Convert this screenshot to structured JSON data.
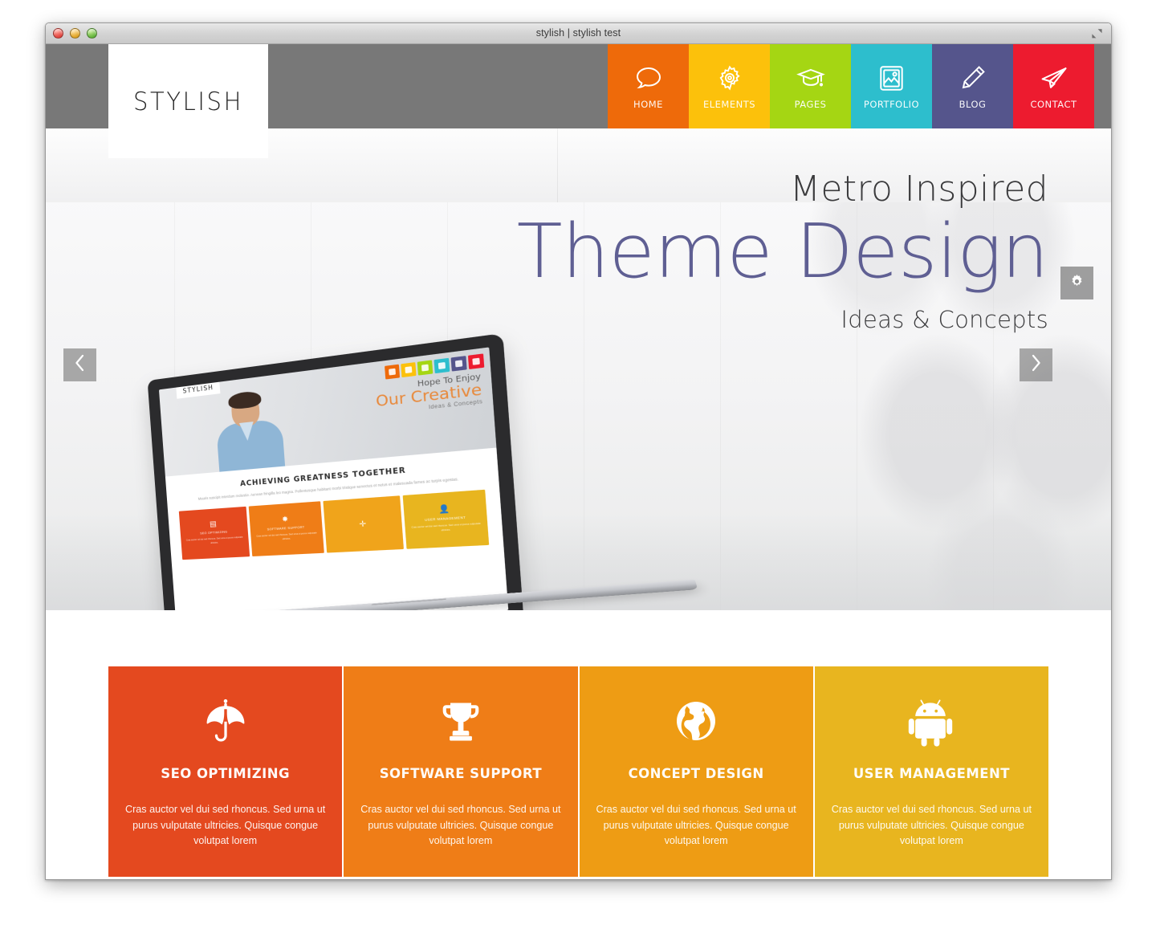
{
  "window": {
    "title": "stylish | stylish test",
    "traffic_lights": [
      "close",
      "minimize",
      "maximize"
    ],
    "fullscreen_icon": "fullscreen-expand-icon"
  },
  "header": {
    "logo_text": "STYLISH",
    "background_color": "#787878",
    "nav": [
      {
        "label": "HOME",
        "icon": "speech-bubble-icon",
        "color": "#ee6a0a"
      },
      {
        "label": "ELEMENTS",
        "icon": "gear-icon",
        "color": "#fcc10b"
      },
      {
        "label": "PAGES",
        "icon": "graduation-cap-icon",
        "color": "#a5d613"
      },
      {
        "label": "PORTFOLIO",
        "icon": "image-picture-icon",
        "color": "#2dbecd"
      },
      {
        "label": "BLOG",
        "icon": "pencil-icon",
        "color": "#55558c"
      },
      {
        "label": "CONTACT",
        "icon": "paper-plane-icon",
        "color": "#ed1b2f"
      }
    ]
  },
  "hero": {
    "line1": "Metro Inspired",
    "line2": "Theme Design",
    "line3": "Ideas & Concepts",
    "line2_color": "#5f5f93",
    "prev_icon": "chevron-left-icon",
    "next_icon": "chevron-right-icon",
    "settings_icon": "gear-icon",
    "laptop": {
      "logo_text": "STYLISH",
      "eyebrow": "Hope To Enjoy",
      "headline": "Our Creative",
      "tagline": "Ideas & Concepts",
      "section_heading": "ACHIEVING GREATNESS TOGETHER",
      "section_text": "Mauris suscipit interdum molestie. Aenean fringilla leo magna. Pellentesque habitant morbi tristique senectus et netus et malesuada fames ac turpis egestas.",
      "nav_colors": [
        "#ee6a0a",
        "#fcc10b",
        "#a5d613",
        "#2dbecd",
        "#55558c",
        "#ed1b2f"
      ],
      "tiles": [
        {
          "label": "SEO OPTIMIZING",
          "icon": "seo-icon",
          "color": "#e4491f",
          "text": "Cras auctor vel dui sed rhoncus. Sed urna ut purus vulputate ultricies."
        },
        {
          "label": "SOFTWARE SUPPORT",
          "icon": "gear-icon",
          "color": "#ef7d17",
          "text": "Cras auctor vel dui sed rhoncus. Sed urna ut purus vulputate ultricies."
        },
        {
          "label": "",
          "icon": "plus-icon",
          "color": "#f0a41b",
          "text": ""
        },
        {
          "label": "USER MANAGEMENT",
          "icon": "user-icon",
          "color": "#e8b51f",
          "text": "Cras auctor vel dui sed rhoncus. Sed urna ut purus vulputate ultricies."
        }
      ]
    }
  },
  "features": {
    "body_text": "Cras auctor vel dui sed rhoncus. Sed urna ut purus vulputate ultricies. Quisque congue volutpat lorem",
    "cards": [
      {
        "title": "SEO OPTIMIZING",
        "icon": "umbrella-icon",
        "color": "#e4491f",
        "text": "Cras auctor vel dui sed rhoncus. Sed urna ut purus vulputate ultricies. Quisque congue volutpat lorem"
      },
      {
        "title": "SOFTWARE SUPPORT",
        "icon": "trophy-icon",
        "color": "#ef7d17",
        "text": "Cras auctor vel dui sed rhoncus. Sed urna ut purus vulputate ultricies. Quisque congue volutpat lorem"
      },
      {
        "title": "CONCEPT DESIGN",
        "icon": "globe-icon",
        "color": "#ee9c14",
        "text": "Cras auctor vel dui sed rhoncus. Sed urna ut purus vulputate ultricies. Quisque congue volutpat lorem"
      },
      {
        "title": "USER MANAGEMENT",
        "icon": "android-robot-icon",
        "color": "#e8b51f",
        "text": "Cras auctor vel dui sed rhoncus. Sed urna ut purus vulputate ultricies. Quisque congue volutpat lorem"
      }
    ]
  }
}
